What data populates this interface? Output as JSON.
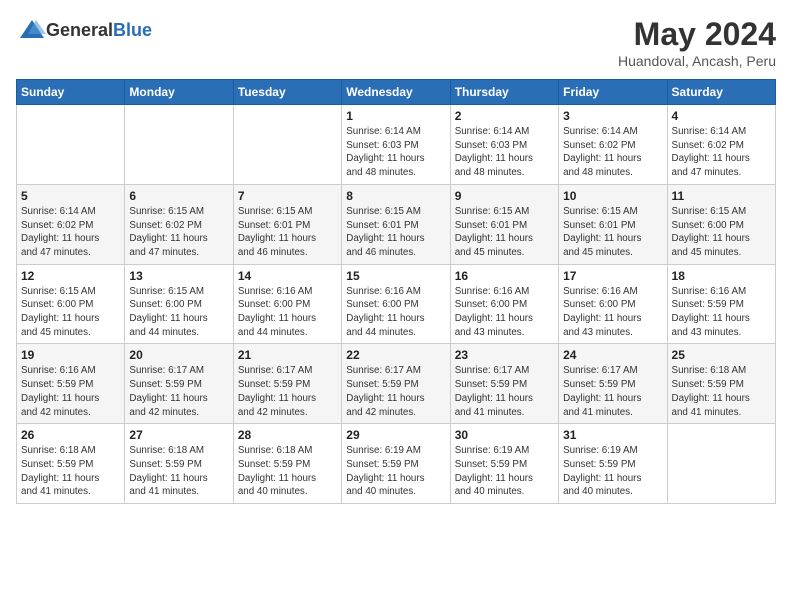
{
  "logo": {
    "general": "General",
    "blue": "Blue"
  },
  "header": {
    "month": "May 2024",
    "location": "Huandoval, Ancash, Peru"
  },
  "weekdays": [
    "Sunday",
    "Monday",
    "Tuesday",
    "Wednesday",
    "Thursday",
    "Friday",
    "Saturday"
  ],
  "weeks": [
    [
      {
        "day": "",
        "sunrise": "",
        "sunset": "",
        "daylight_hours": "",
        "daylight_minutes": ""
      },
      {
        "day": "",
        "sunrise": "",
        "sunset": "",
        "daylight_hours": "",
        "daylight_minutes": ""
      },
      {
        "day": "",
        "sunrise": "",
        "sunset": "",
        "daylight_hours": "",
        "daylight_minutes": ""
      },
      {
        "day": "1",
        "sunrise": "6:14 AM",
        "sunset": "6:03 PM",
        "daylight_hours": "11",
        "daylight_minutes": "48"
      },
      {
        "day": "2",
        "sunrise": "6:14 AM",
        "sunset": "6:03 PM",
        "daylight_hours": "11",
        "daylight_minutes": "48"
      },
      {
        "day": "3",
        "sunrise": "6:14 AM",
        "sunset": "6:02 PM",
        "daylight_hours": "11",
        "daylight_minutes": "48"
      },
      {
        "day": "4",
        "sunrise": "6:14 AM",
        "sunset": "6:02 PM",
        "daylight_hours": "11",
        "daylight_minutes": "47"
      }
    ],
    [
      {
        "day": "5",
        "sunrise": "6:14 AM",
        "sunset": "6:02 PM",
        "daylight_hours": "11",
        "daylight_minutes": "47"
      },
      {
        "day": "6",
        "sunrise": "6:15 AM",
        "sunset": "6:02 PM",
        "daylight_hours": "11",
        "daylight_minutes": "47"
      },
      {
        "day": "7",
        "sunrise": "6:15 AM",
        "sunset": "6:01 PM",
        "daylight_hours": "11",
        "daylight_minutes": "46"
      },
      {
        "day": "8",
        "sunrise": "6:15 AM",
        "sunset": "6:01 PM",
        "daylight_hours": "11",
        "daylight_minutes": "46"
      },
      {
        "day": "9",
        "sunrise": "6:15 AM",
        "sunset": "6:01 PM",
        "daylight_hours": "11",
        "daylight_minutes": "45"
      },
      {
        "day": "10",
        "sunrise": "6:15 AM",
        "sunset": "6:01 PM",
        "daylight_hours": "11",
        "daylight_minutes": "45"
      },
      {
        "day": "11",
        "sunrise": "6:15 AM",
        "sunset": "6:00 PM",
        "daylight_hours": "11",
        "daylight_minutes": "45"
      }
    ],
    [
      {
        "day": "12",
        "sunrise": "6:15 AM",
        "sunset": "6:00 PM",
        "daylight_hours": "11",
        "daylight_minutes": "45"
      },
      {
        "day": "13",
        "sunrise": "6:15 AM",
        "sunset": "6:00 PM",
        "daylight_hours": "11",
        "daylight_minutes": "44"
      },
      {
        "day": "14",
        "sunrise": "6:16 AM",
        "sunset": "6:00 PM",
        "daylight_hours": "11",
        "daylight_minutes": "44"
      },
      {
        "day": "15",
        "sunrise": "6:16 AM",
        "sunset": "6:00 PM",
        "daylight_hours": "11",
        "daylight_minutes": "44"
      },
      {
        "day": "16",
        "sunrise": "6:16 AM",
        "sunset": "6:00 PM",
        "daylight_hours": "11",
        "daylight_minutes": "43"
      },
      {
        "day": "17",
        "sunrise": "6:16 AM",
        "sunset": "6:00 PM",
        "daylight_hours": "11",
        "daylight_minutes": "43"
      },
      {
        "day": "18",
        "sunrise": "6:16 AM",
        "sunset": "5:59 PM",
        "daylight_hours": "11",
        "daylight_minutes": "43"
      }
    ],
    [
      {
        "day": "19",
        "sunrise": "6:16 AM",
        "sunset": "5:59 PM",
        "daylight_hours": "11",
        "daylight_minutes": "42"
      },
      {
        "day": "20",
        "sunrise": "6:17 AM",
        "sunset": "5:59 PM",
        "daylight_hours": "11",
        "daylight_minutes": "42"
      },
      {
        "day": "21",
        "sunrise": "6:17 AM",
        "sunset": "5:59 PM",
        "daylight_hours": "11",
        "daylight_minutes": "42"
      },
      {
        "day": "22",
        "sunrise": "6:17 AM",
        "sunset": "5:59 PM",
        "daylight_hours": "11",
        "daylight_minutes": "42"
      },
      {
        "day": "23",
        "sunrise": "6:17 AM",
        "sunset": "5:59 PM",
        "daylight_hours": "11",
        "daylight_minutes": "41"
      },
      {
        "day": "24",
        "sunrise": "6:17 AM",
        "sunset": "5:59 PM",
        "daylight_hours": "11",
        "daylight_minutes": "41"
      },
      {
        "day": "25",
        "sunrise": "6:18 AM",
        "sunset": "5:59 PM",
        "daylight_hours": "11",
        "daylight_minutes": "41"
      }
    ],
    [
      {
        "day": "26",
        "sunrise": "6:18 AM",
        "sunset": "5:59 PM",
        "daylight_hours": "11",
        "daylight_minutes": "41"
      },
      {
        "day": "27",
        "sunrise": "6:18 AM",
        "sunset": "5:59 PM",
        "daylight_hours": "11",
        "daylight_minutes": "41"
      },
      {
        "day": "28",
        "sunrise": "6:18 AM",
        "sunset": "5:59 PM",
        "daylight_hours": "11",
        "daylight_minutes": "40"
      },
      {
        "day": "29",
        "sunrise": "6:19 AM",
        "sunset": "5:59 PM",
        "daylight_hours": "11",
        "daylight_minutes": "40"
      },
      {
        "day": "30",
        "sunrise": "6:19 AM",
        "sunset": "5:59 PM",
        "daylight_hours": "11",
        "daylight_minutes": "40"
      },
      {
        "day": "31",
        "sunrise": "6:19 AM",
        "sunset": "5:59 PM",
        "daylight_hours": "11",
        "daylight_minutes": "40"
      },
      {
        "day": "",
        "sunrise": "",
        "sunset": "",
        "daylight_hours": "",
        "daylight_minutes": ""
      }
    ]
  ]
}
